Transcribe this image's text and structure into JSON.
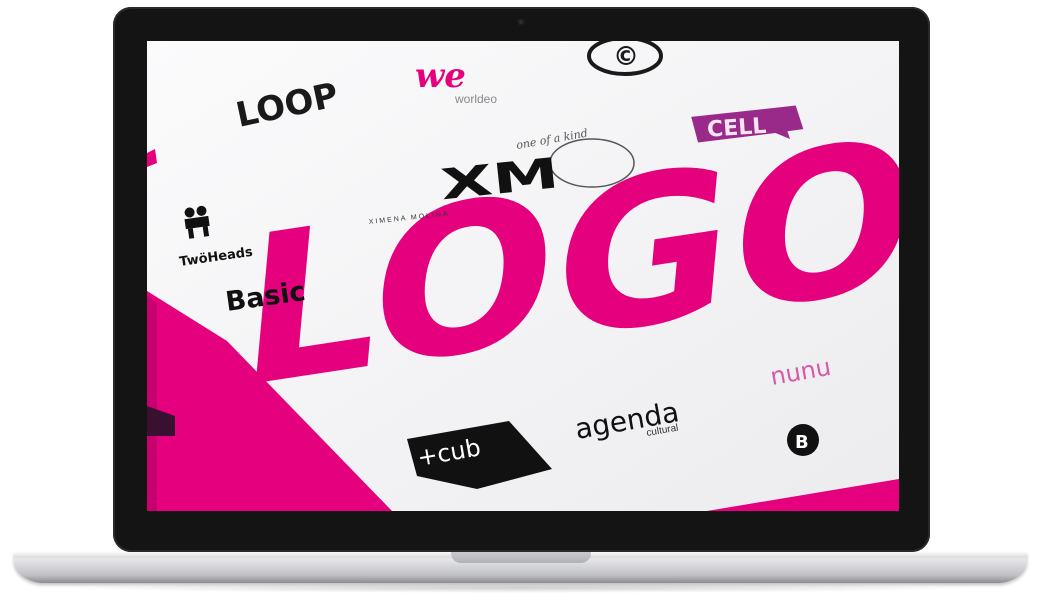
{
  "device": {
    "type": "laptop"
  },
  "book_cover": {
    "title": "LOGOS",
    "brand_colors": {
      "accent": "#e5007e",
      "page": "#f1f1f3",
      "ink": "#111111"
    },
    "logos": [
      {
        "id": "loop",
        "text": "LOOP"
      },
      {
        "id": "worldeo",
        "mark": "we",
        "text": "worldeo"
      },
      {
        "id": "copyright",
        "text": "©"
      },
      {
        "id": "cell",
        "text": "CELL"
      },
      {
        "id": "one-of-a-kind",
        "text": "one of a kind"
      },
      {
        "id": "ximena-molina",
        "mark": "XM",
        "text": "XIMENA MOLINA"
      },
      {
        "id": "twoheads",
        "text": "TwöHeads"
      },
      {
        "id": "basic",
        "text": "Basic"
      },
      {
        "id": "nunu",
        "text": "nunu"
      },
      {
        "id": "agenda-cultural",
        "text": "agenda",
        "subtext": "cultural"
      },
      {
        "id": "cub",
        "text": "+cub"
      },
      {
        "id": "b-badge",
        "text": "B"
      }
    ]
  }
}
